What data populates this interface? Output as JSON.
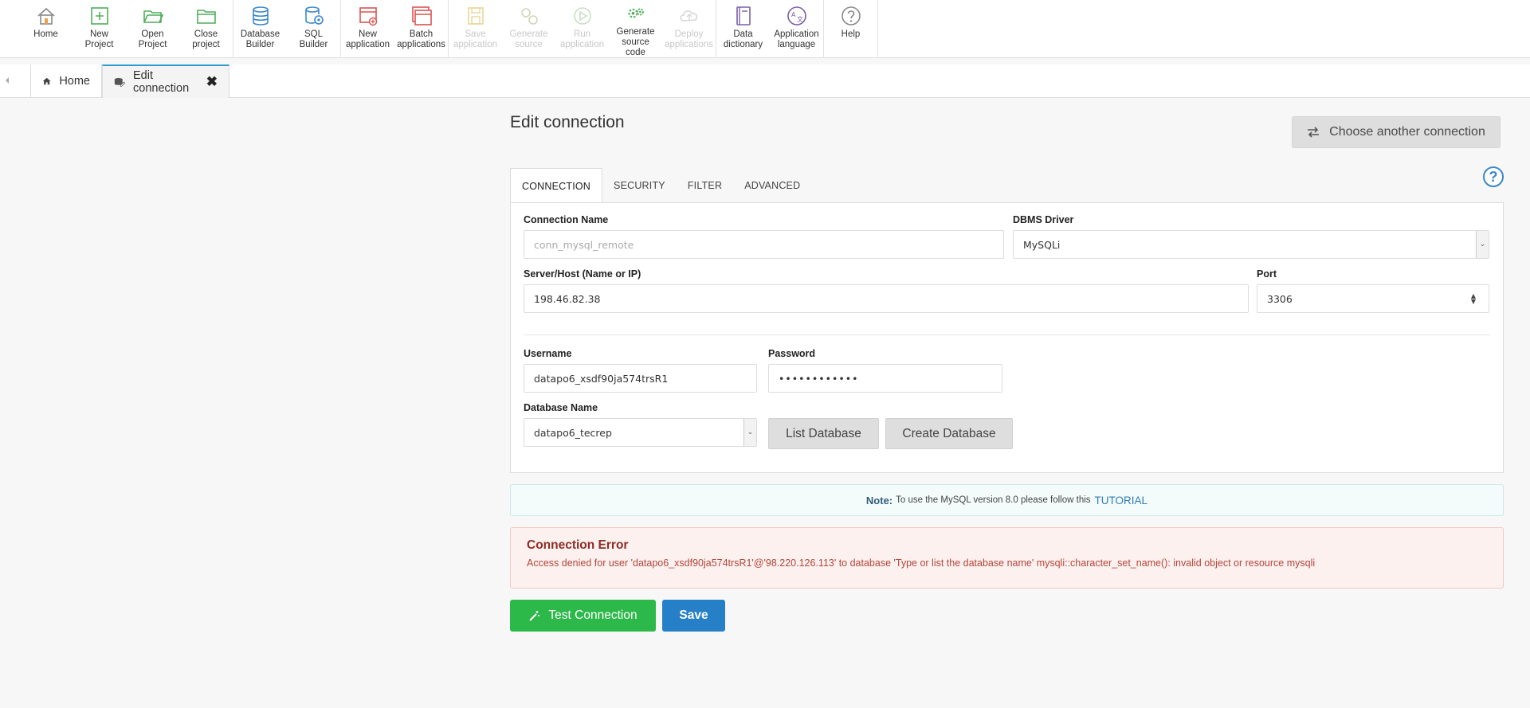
{
  "toolbar": {
    "home": "Home",
    "new_project": "New\nProject",
    "open_project": "Open\nProject",
    "close_project": "Close\nproject",
    "database_builder": "Database\nBuilder",
    "sql_builder": "SQL\nBuilder",
    "new_application": "New\napplication",
    "batch_applications": "Batch\napplications",
    "save_application": "Save\napplication",
    "generate_source": "Generate\nsource",
    "run_application": "Run\napplication",
    "generate_source_code": "Generate\nsource\ncode",
    "deploy_applications": "Deploy\napplications",
    "data_dictionary": "Data\ndictionary",
    "application_language": "Application\nlanguage",
    "help": "Help"
  },
  "doc_tabs": {
    "home": "Home",
    "edit_connection": "Edit connection"
  },
  "page": {
    "title": "Edit connection",
    "choose_another": "Choose another connection",
    "help_icon": "?"
  },
  "form_tabs": [
    "CONNECTION",
    "SECURITY",
    "FILTER",
    "ADVANCED"
  ],
  "form": {
    "connection_name_label": "Connection Name",
    "connection_name_value": "conn_mysql_remote",
    "dbms_driver_label": "DBMS Driver",
    "dbms_driver_value": "MySQLi",
    "server_label": "Server/Host (Name or IP)",
    "server_value": "198.46.82.38",
    "port_label": "Port",
    "port_value": "3306",
    "username_label": "Username",
    "username_value": "datapo6_xsdf90ja574trsR1",
    "password_label": "Password",
    "password_value": "••••••••••••",
    "database_name_label": "Database Name",
    "database_name_value": "datapo6_tecrep",
    "list_database": "List Database",
    "create_database": "Create Database"
  },
  "note": {
    "label": "Note:",
    "text": "To use the MySQL version 8.0 please follow this",
    "link": "TUTORIAL"
  },
  "error": {
    "title": "Connection Error",
    "message": "Access denied for user 'datapo6_xsdf90ja574trsR1'@'98.220.126.113' to database 'Type or list the database name' mysqli::character_set_name(): invalid object or resource mysqli"
  },
  "actions": {
    "test_connection": "Test Connection",
    "save": "Save"
  },
  "colors": {
    "accent_blue": "#2680c7",
    "success_green": "#2db84a",
    "error_red": "#8c2e25"
  }
}
